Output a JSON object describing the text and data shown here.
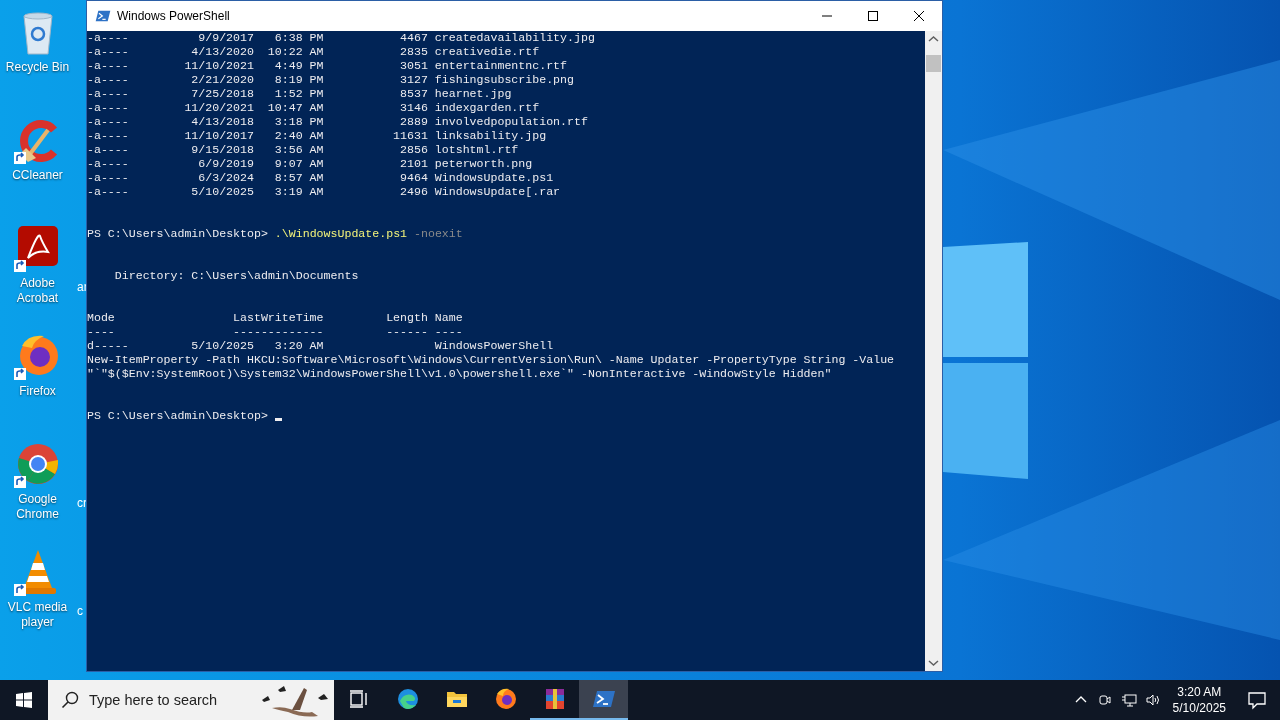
{
  "desktop_icons": [
    {
      "kind": "recycle-bin",
      "label": "Recycle Bin",
      "shortcut": false
    },
    {
      "kind": "ccleaner",
      "label": "CCleaner",
      "shortcut": true
    },
    {
      "kind": "acrobat",
      "label": "Adobe Acrobat",
      "shortcut": true,
      "beside": "ar"
    },
    {
      "kind": "firefox",
      "label": "Firefox",
      "shortcut": true
    },
    {
      "kind": "chrome",
      "label": "Google Chrome",
      "shortcut": true,
      "beside": "cr"
    },
    {
      "kind": "vlc",
      "label": "VLC media player",
      "shortcut": true,
      "beside": "c"
    }
  ],
  "window": {
    "title": "Windows PowerShell"
  },
  "console": {
    "listing_rows": [
      {
        "mode": "-a----",
        "date": "9/9/2017",
        "time": "6:38 PM",
        "length": "4467",
        "name": "createdavailability.jpg"
      },
      {
        "mode": "-a----",
        "date": "4/13/2020",
        "time": "10:22 AM",
        "length": "2835",
        "name": "creativedie.rtf"
      },
      {
        "mode": "-a----",
        "date": "11/10/2021",
        "time": "4:49 PM",
        "length": "3051",
        "name": "entertainmentnc.rtf"
      },
      {
        "mode": "-a----",
        "date": "2/21/2020",
        "time": "8:19 PM",
        "length": "3127",
        "name": "fishingsubscribe.png"
      },
      {
        "mode": "-a----",
        "date": "7/25/2018",
        "time": "1:52 PM",
        "length": "8537",
        "name": "hearnet.jpg"
      },
      {
        "mode": "-a----",
        "date": "11/20/2021",
        "time": "10:47 AM",
        "length": "3146",
        "name": "indexgarden.rtf"
      },
      {
        "mode": "-a----",
        "date": "4/13/2018",
        "time": "3:18 PM",
        "length": "2889",
        "name": "involvedpopulation.rtf"
      },
      {
        "mode": "-a----",
        "date": "11/10/2017",
        "time": "2:40 AM",
        "length": "11631",
        "name": "linksability.jpg"
      },
      {
        "mode": "-a----",
        "date": "9/15/2018",
        "time": "3:56 AM",
        "length": "2856",
        "name": "lotshtml.rtf"
      },
      {
        "mode": "-a----",
        "date": "6/9/2019",
        "time": "9:07 AM",
        "length": "2101",
        "name": "peterworth.png"
      },
      {
        "mode": "-a----",
        "date": "6/3/2024",
        "time": "8:57 AM",
        "length": "9464",
        "name": "WindowsUpdate.ps1"
      },
      {
        "mode": "-a----",
        "date": "5/10/2025",
        "time": "3:19 AM",
        "length": "2496",
        "name": "WindowsUpdate[.rar"
      }
    ],
    "command": {
      "prompt": "PS C:\\Users\\admin\\Desktop>",
      "command": ".\\WindowsUpdate.ps1",
      "argument": "-noexit"
    },
    "directory": {
      "heading": "Directory: C:\\Users\\admin\\Documents",
      "columns": [
        "Mode",
        "LastWriteTime",
        "Length",
        "Name"
      ],
      "rules": [
        "----",
        "-------------",
        "------",
        "----"
      ],
      "rows": [
        {
          "mode": "d-----",
          "date": "5/10/2025",
          "time": "3:20 AM",
          "name": "WindowsPowerShell"
        }
      ]
    },
    "output": "New-ItemProperty -Path HKCU:Software\\Microsoft\\Windows\\CurrentVersion\\Run\\ -Name Updater -PropertyType String -Value \"`\"$($Env:SystemRoot)\\System32\\WindowsPowerShell\\v1.0\\powershell.exe`\" -NonInteractive -WindowStyle Hidden\"",
    "prompt": "PS C:\\Users\\admin\\Desktop>"
  },
  "taskbar": {
    "search": {
      "placeholder": "Type here to search"
    },
    "apps": [
      {
        "kind": "edge",
        "running": false,
        "selected": false
      },
      {
        "kind": "explorer",
        "running": false,
        "selected": false
      },
      {
        "kind": "firefox",
        "running": false,
        "selected": false
      },
      {
        "kind": "winrar",
        "running": true,
        "selected": false
      },
      {
        "kind": "powershell",
        "running": true,
        "selected": true
      }
    ],
    "clock": {
      "time": "3:20 AM",
      "date": "5/10/2025"
    }
  }
}
